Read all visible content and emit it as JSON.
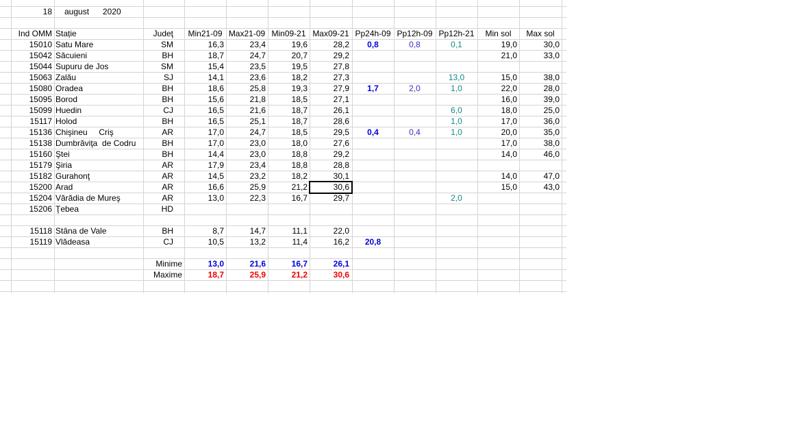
{
  "colors": {
    "blue": "#0000dd",
    "medblue": "#3333bb",
    "teal": "#118888",
    "red": "#ee0000",
    "grid": "#d4d4d4"
  },
  "date": {
    "day": "18",
    "month": "august",
    "year": "2020"
  },
  "headers": [
    "Ind OMM",
    "Stație",
    "Judeţ",
    "Min21-09",
    "Max21-09",
    "Min09-21",
    "Max09-21",
    "Pp24h-09",
    "Pp12h-09",
    "Pp12h-21",
    "Min sol",
    "Max sol"
  ],
  "rows": [
    {
      "ind": "15010",
      "station": "Satu Mare",
      "county": "SM",
      "min2109": "16,3",
      "max2109": "23,4",
      "min0921": "19,6",
      "max0921": "28,2",
      "pp24": "0,8",
      "pp12a": "0,8",
      "pp12b": "0,1",
      "minsol": "19,0",
      "maxsol": "30,0"
    },
    {
      "ind": "15042",
      "station": "Săcuieni",
      "county": "BH",
      "min2109": "18,7",
      "max2109": "24,7",
      "min0921": "20,7",
      "max0921": "29,2",
      "pp24": "",
      "pp12a": "",
      "pp12b": "",
      "minsol": "21,0",
      "maxsol": "33,0"
    },
    {
      "ind": "15044",
      "station": "Supuru de Jos",
      "county": "SM",
      "min2109": "15,4",
      "max2109": "23,5",
      "min0921": "19,5",
      "max0921": "27,8",
      "pp24": "",
      "pp12a": "",
      "pp12b": "",
      "minsol": "",
      "maxsol": ""
    },
    {
      "ind": "15063",
      "station": "Zalău",
      "county": "SJ",
      "min2109": "14,1",
      "max2109": "23,6",
      "min0921": "18,2",
      "max0921": "27,3",
      "pp24": "",
      "pp12a": "",
      "pp12b": "13,0",
      "minsol": "15,0",
      "maxsol": "38,0"
    },
    {
      "ind": "15080",
      "station": "Oradea",
      "county": "BH",
      "min2109": "18,6",
      "max2109": "25,8",
      "min0921": "19,3",
      "max0921": "27,9",
      "pp24": "1,7",
      "pp12a": "2,0",
      "pp12b": "1,0",
      "minsol": "22,0",
      "maxsol": "28,0"
    },
    {
      "ind": "15095",
      "station": "Borod",
      "county": "BH",
      "min2109": "15,6",
      "max2109": "21,8",
      "min0921": "18,5",
      "max0921": "27,1",
      "pp24": "",
      "pp12a": "",
      "pp12b": "",
      "minsol": "16,0",
      "maxsol": "39,0"
    },
    {
      "ind": "15099",
      "station": "Huedin",
      "county": "CJ",
      "min2109": "16,5",
      "max2109": "21,6",
      "min0921": "18,7",
      "max0921": "26,1",
      "pp24": "",
      "pp12a": "",
      "pp12b": "6,0",
      "minsol": "18,0",
      "maxsol": "25,0"
    },
    {
      "ind": "15117",
      "station": "Holod",
      "county": "BH",
      "min2109": "16,5",
      "max2109": "25,1",
      "min0921": "18,7",
      "max0921": "28,6",
      "pp24": "",
      "pp12a": "",
      "pp12b": "1,0",
      "minsol": "17,0",
      "maxsol": "36,0"
    },
    {
      "ind": "15136",
      "station": "Chişineu     Criş",
      "county": "AR",
      "min2109": "17,0",
      "max2109": "24,7",
      "min0921": "18,5",
      "max0921": "29,5",
      "pp24": "0,4",
      "pp12a": "0,4",
      "pp12b": "1,0",
      "minsol": "20,0",
      "maxsol": "35,0"
    },
    {
      "ind": "15138",
      "station": "Dumbrăviţa  de Codru",
      "county": "BH",
      "min2109": "17,0",
      "max2109": "23,0",
      "min0921": "18,0",
      "max0921": "27,6",
      "pp24": "",
      "pp12a": "",
      "pp12b": "",
      "minsol": "17,0",
      "maxsol": "38,0"
    },
    {
      "ind": "15160",
      "station": "Ştei",
      "county": "BH",
      "min2109": "14,4",
      "max2109": "23,0",
      "min0921": "18,8",
      "max0921": "29,2",
      "pp24": "",
      "pp12a": "",
      "pp12b": "",
      "minsol": "14,0",
      "maxsol": "46,0"
    },
    {
      "ind": "15179",
      "station": "Şiria",
      "county": "AR",
      "min2109": "17,9",
      "max2109": "23,4",
      "min0921": "18,8",
      "max0921": "28,8",
      "pp24": "",
      "pp12a": "",
      "pp12b": "",
      "minsol": "",
      "maxsol": ""
    },
    {
      "ind": "15182",
      "station": "Gurahonţ",
      "county": "AR",
      "min2109": "14,5",
      "max2109": "23,2",
      "min0921": "18,2",
      "max0921": "30,1",
      "pp24": "",
      "pp12a": "",
      "pp12b": "",
      "minsol": "14,0",
      "maxsol": "47,0"
    },
    {
      "ind": "15200",
      "station": "Arad",
      "county": "AR",
      "min2109": "16,6",
      "max2109": "25,9",
      "min0921": "21,2",
      "max0921": "30,6",
      "pp24": "",
      "pp12a": "",
      "pp12b": "",
      "minsol": "15,0",
      "maxsol": "43,0"
    },
    {
      "ind": "15204",
      "station": "Vărădia de Mureş",
      "county": "AR",
      "min2109": "13,0",
      "max2109": "22,3",
      "min0921": "16,7",
      "max0921": "29,7",
      "pp24": "",
      "pp12a": "",
      "pp12b": "2,0",
      "minsol": "",
      "maxsol": ""
    },
    {
      "ind": "15206",
      "station": "Ţebea",
      "county": "HD",
      "min2109": "",
      "max2109": "",
      "min0921": "",
      "max0921": "",
      "pp24": "",
      "pp12a": "",
      "pp12b": "",
      "minsol": "",
      "maxsol": ""
    }
  ],
  "mountain_rows": [
    {
      "ind": "15118",
      "station": "Stâna de Vale",
      "county": "BH",
      "min2109": "8,7",
      "max2109": "14,7",
      "min0921": "11,1",
      "max0921": "22,0",
      "pp24": "",
      "pp12a": "",
      "pp12b": "",
      "minsol": "",
      "maxsol": ""
    },
    {
      "ind": "15119",
      "station": "Vlădeasa",
      "county": "CJ",
      "min2109": "10,5",
      "max2109": "13,2",
      "min0921": "11,4",
      "max0921": "16,2",
      "pp24": "20,8",
      "pp12a": "",
      "pp12b": "",
      "minsol": "",
      "maxsol": ""
    }
  ],
  "summary": {
    "minime": {
      "label": "Minime",
      "values": [
        "13,0",
        "21,6",
        "16,7",
        "26,1"
      ]
    },
    "maxime": {
      "label": "Maxime",
      "values": [
        "18,7",
        "25,9",
        "21,2",
        "30,6"
      ]
    }
  }
}
